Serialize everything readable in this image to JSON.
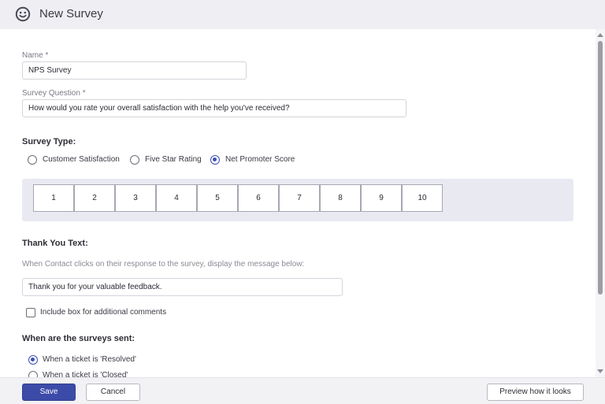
{
  "header": {
    "title": "New Survey",
    "icon": "smiley-icon"
  },
  "form": {
    "name_label": "Name *",
    "name_value": "NPS Survey",
    "question_label": "Survey Question *",
    "question_value": "How would you rate your overall satisfaction with the help you've received?",
    "survey_type_label": "Survey Type:",
    "survey_types": [
      {
        "label": "Customer Satisfaction",
        "selected": false
      },
      {
        "label": "Five Star Rating",
        "selected": false
      },
      {
        "label": "Net Promoter Score",
        "selected": true
      }
    ],
    "scale": [
      "1",
      "2",
      "3",
      "4",
      "5",
      "6",
      "7",
      "8",
      "9",
      "10"
    ],
    "thank_you_label": "Thank You Text:",
    "thank_you_hint": "When Contact clicks on their response to the survey, display the message below:",
    "thank_you_value": "Thank you for your valuable feedback.",
    "comments_checkbox": {
      "label": "Include box for additional comments",
      "checked": false
    },
    "sent_label": "When are the surveys sent:",
    "sent_options": [
      {
        "label": "When a ticket is 'Resolved'",
        "selected": true
      },
      {
        "label": "When a ticket is 'Closed'",
        "selected": false
      }
    ]
  },
  "footer": {
    "save_label": "Save",
    "cancel_label": "Cancel",
    "preview_label": "Preview how it looks"
  },
  "colors": {
    "accent": "#3c4ba8",
    "header_bg": "#eeeef3",
    "scale_bg": "#e9e9f2"
  }
}
